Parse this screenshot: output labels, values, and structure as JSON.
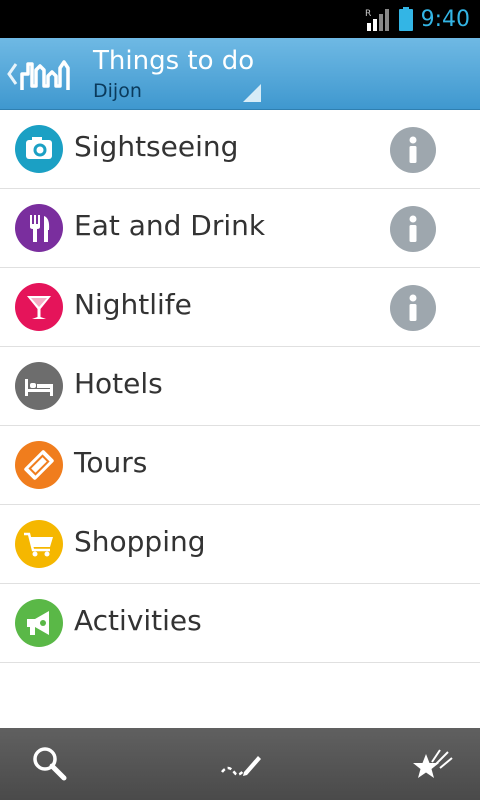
{
  "status_bar": {
    "time": "9:40",
    "signal_badge": "R",
    "icons": [
      "signal-icon",
      "battery-icon"
    ],
    "time_color": "#33b5e5"
  },
  "app_bar": {
    "title": "Things to do",
    "subtitle": "Dijon",
    "icons": [
      "back-chevron-icon",
      "city-skyline-logo-icon",
      "dropdown-arrow-icon"
    ]
  },
  "categories": [
    {
      "label": "Sightseeing",
      "icon": "camera-icon",
      "color": "#1ba0c4",
      "info": true
    },
    {
      "label": "Eat and Drink",
      "icon": "fork-knife-icon",
      "color": "#7a2e9e",
      "info": true
    },
    {
      "label": "Nightlife",
      "icon": "cocktail-glass-icon",
      "color": "#e5145a",
      "info": true
    },
    {
      "label": "Hotels",
      "icon": "bed-icon",
      "color": "#6d6d6d",
      "info": false
    },
    {
      "label": "Tours",
      "icon": "ticket-icon",
      "color": "#f07d1d",
      "info": false
    },
    {
      "label": "Shopping",
      "icon": "shopping-cart-icon",
      "color": "#f5b700",
      "info": false
    },
    {
      "label": "Activities",
      "icon": "megaphone-icon",
      "color": "#5ab847",
      "info": false
    }
  ],
  "bottom_bar": {
    "items": [
      "search-icon",
      "route-pencil-icon",
      "favorites-stars-icon"
    ]
  }
}
